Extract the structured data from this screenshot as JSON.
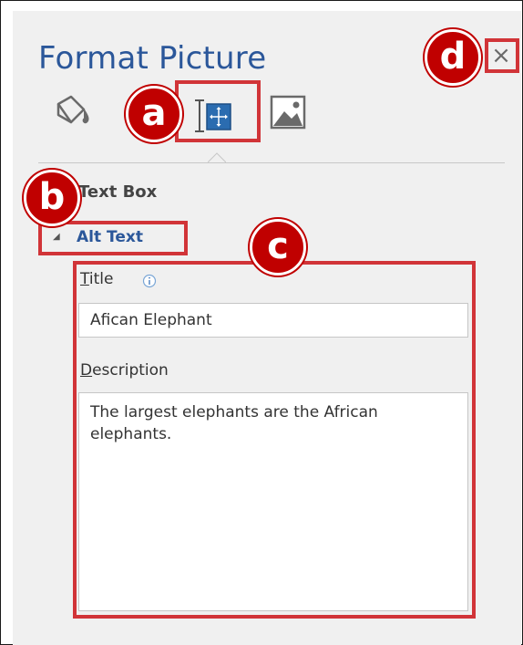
{
  "pane": {
    "title": "Format Picture",
    "close_glyph": "×"
  },
  "tabs": [
    {
      "icon": "fill-line-icon"
    },
    {
      "icon": "layout-properties-icon",
      "selected": true
    },
    {
      "icon": "picture-icon"
    }
  ],
  "section": {
    "heading": "Text Box"
  },
  "subsection": {
    "label": "Alt Text",
    "toggle_glyph": "◢"
  },
  "fields": {
    "title_label_first": "T",
    "title_label_rest": "itle",
    "title_value": "Afican Elephant",
    "description_label_first": "D",
    "description_label_rest": "escription",
    "description_value": "The largest elephants are the African elephants."
  },
  "annotations": {
    "a": "a",
    "b": "b",
    "c": "c",
    "d": "d",
    "color": "#c00000"
  },
  "colors": {
    "accent": "#2b579a",
    "panel_bg": "#f0f0f0",
    "annotation_border": "#d13438"
  }
}
